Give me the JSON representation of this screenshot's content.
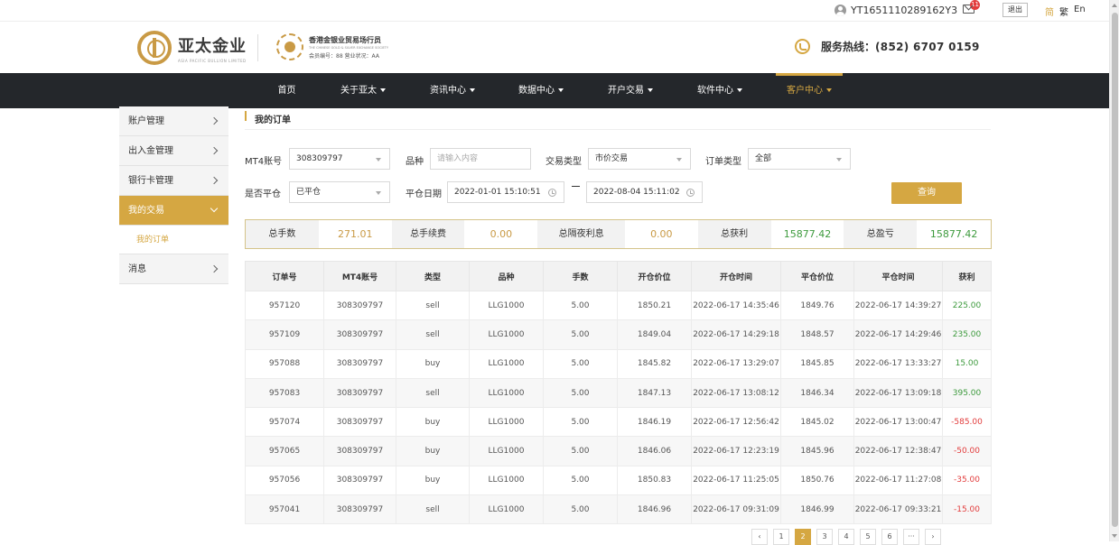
{
  "topbar": {
    "username": "YT1651110289162Y3",
    "mail_badge": "11",
    "logout_label": "退出",
    "lang": [
      "简",
      "繁",
      "En"
    ]
  },
  "header": {
    "logo_text": "亚太金业",
    "logo_sub": "ASIA PACIFIC BULLION LIMITED",
    "society_name": "香港金银业贸易场行员",
    "society_en": "THE CHINESE GOLD & SILVER EXCHANGE SOCIETY",
    "society_member": "会员编号：88   营业状况：AA",
    "hotline_label": "服务热线：",
    "hotline_number": "(852)  6707 0159"
  },
  "nav": {
    "items": [
      {
        "label": "首页",
        "caret": false
      },
      {
        "label": "关于亚太",
        "caret": true
      },
      {
        "label": "资讯中心",
        "caret": true
      },
      {
        "label": "数据中心",
        "caret": true
      },
      {
        "label": "开户交易",
        "caret": true
      },
      {
        "label": "软件中心",
        "caret": true
      },
      {
        "label": "客户中心",
        "caret": true
      }
    ]
  },
  "sidebar": {
    "items": [
      {
        "label": "账户管理"
      },
      {
        "label": "出入金管理"
      },
      {
        "label": "银行卡管理"
      },
      {
        "label": "我的交易"
      },
      {
        "label": "消息"
      }
    ],
    "sub_item": "我的订单"
  },
  "page": {
    "title": "我的订单"
  },
  "filters": {
    "mt4_label": "MT4账号",
    "mt4_value": "308309797",
    "symbol_label": "品种",
    "symbol_placeholder": "请输入内容",
    "trade_type_label": "交易类型",
    "trade_type_value": "市价交易",
    "order_type_label": "订单类型",
    "order_type_value": "全部",
    "closed_label": "是否平仓",
    "closed_value": "已平仓",
    "close_date_label": "平仓日期",
    "date_from": "2022-01-01 15:10:51",
    "date_to": "2022-08-04 15:11:02",
    "query_label": "查询"
  },
  "summary": {
    "lots_label": "总手数",
    "lots": "271.01",
    "fee_label": "总手续费",
    "fee": "0.00",
    "overnight_label": "总隔夜利息",
    "overnight": "0.00",
    "profit_label": "总获利",
    "profit": "15877.42",
    "net_label": "总盈亏",
    "net": "15877.42"
  },
  "table": {
    "headers": [
      "订单号",
      "MT4账号",
      "类型",
      "品种",
      "手数",
      "开仓价位",
      "开仓时间",
      "平仓价位",
      "平仓时间",
      "获利"
    ],
    "rows": [
      [
        "957120",
        "308309797",
        "sell",
        "LLG1000",
        "5.00",
        "1850.21",
        "2022-06-17 14:35:46",
        "1849.76",
        "2022-06-17 14:39:27",
        "225.00"
      ],
      [
        "957109",
        "308309797",
        "sell",
        "LLG1000",
        "5.00",
        "1849.04",
        "2022-06-17 14:29:18",
        "1848.57",
        "2022-06-17 14:29:46",
        "235.00"
      ],
      [
        "957088",
        "308309797",
        "buy",
        "LLG1000",
        "5.00",
        "1845.82",
        "2022-06-17 13:29:07",
        "1845.85",
        "2022-06-17 13:33:27",
        "15.00"
      ],
      [
        "957083",
        "308309797",
        "sell",
        "LLG1000",
        "5.00",
        "1847.13",
        "2022-06-17 13:08:12",
        "1846.34",
        "2022-06-17 13:09:18",
        "395.00"
      ],
      [
        "957074",
        "308309797",
        "buy",
        "LLG1000",
        "5.00",
        "1846.19",
        "2022-06-17 12:56:42",
        "1845.02",
        "2022-06-17 13:00:47",
        "-585.00"
      ],
      [
        "957065",
        "308309797",
        "buy",
        "LLG1000",
        "5.00",
        "1846.06",
        "2022-06-17 12:23:19",
        "1845.96",
        "2022-06-17 12:38:47",
        "-50.00"
      ],
      [
        "957056",
        "308309797",
        "buy",
        "LLG1000",
        "5.00",
        "1850.83",
        "2022-06-17 11:25:05",
        "1850.76",
        "2022-06-17 11:27:08",
        "-35.00"
      ],
      [
        "957041",
        "308309797",
        "sell",
        "LLG1000",
        "5.00",
        "1846.96",
        "2022-06-17 09:31:09",
        "1846.99",
        "2022-06-17 09:33:21",
        "-15.00"
      ]
    ]
  },
  "pager": {
    "prev": "‹",
    "pages": [
      "1",
      "2",
      "3",
      "4",
      "5",
      "6"
    ],
    "ellipsis": "···",
    "next": "›",
    "current": "2"
  },
  "colors": {
    "accent": "#d5a742",
    "nav_bg": "#24272b",
    "positive": "#3d9a3d",
    "negative": "#e23c3c"
  }
}
